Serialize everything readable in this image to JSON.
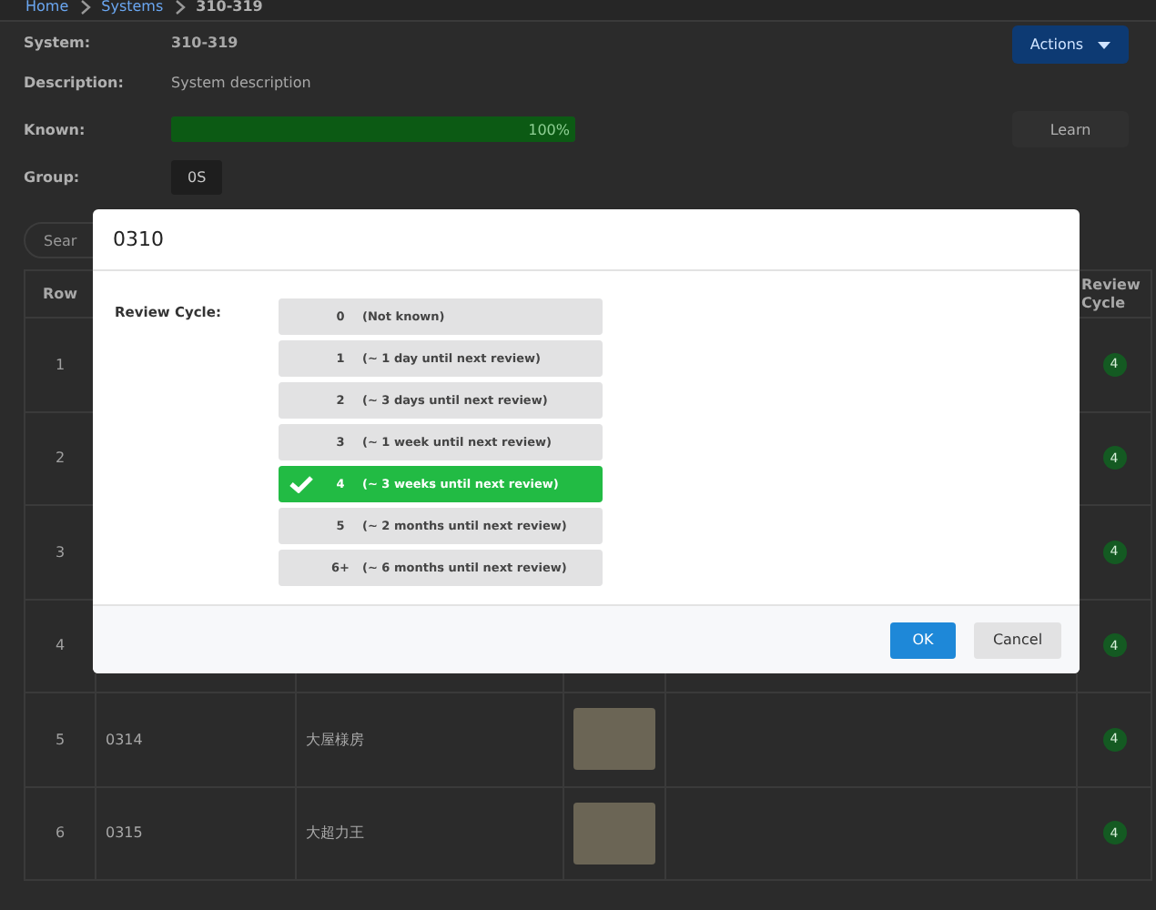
{
  "breadcrumb": [
    "Home",
    "Systems",
    "310-319"
  ],
  "info": {
    "system_label": "System:",
    "system": "310-319",
    "description_label": "Description:",
    "description": "System description",
    "known": {
      "label": "Known:",
      "level": 1.0,
      "reading": "100%"
    },
    "group_label": "Group:",
    "group": "0S"
  },
  "actions_button": "Actions",
  "learn_button": "Learn",
  "search": {
    "placeholder": "Sear"
  },
  "table": {
    "columns": [
      "Row",
      "Review Cycle"
    ],
    "rows": [
      {
        "row": "1",
        "review": "4"
      },
      {
        "row": "2",
        "review": "4"
      },
      {
        "row": "3",
        "review": "4"
      },
      {
        "row": "4",
        "review": "4"
      },
      {
        "row": "5",
        "code": "0314",
        "name": "大屋様房",
        "review": "4",
        "has_photo": true
      },
      {
        "row": "6",
        "code": "0315",
        "name": "大超力王",
        "review": "4",
        "has_photo": true
      }
    ]
  },
  "dialog": {
    "title": "0310",
    "field_label": "Review Cycle:",
    "options": [
      {
        "value": "0",
        "text": "(Not known)",
        "selected": false
      },
      {
        "value": "1",
        "text": "(~ 1 day until next review)",
        "selected": false
      },
      {
        "value": "2",
        "text": "(~ 3 days until next review)",
        "selected": false
      },
      {
        "value": "3",
        "text": "(~ 1 week until next review)",
        "selected": false
      },
      {
        "value": "4",
        "text": "(~ 3 weeks until next review)",
        "selected": true
      },
      {
        "value": "5",
        "text": "(~ 2 months until next review)",
        "selected": false
      },
      {
        "value": "6+",
        "text": "(~ 6 months until next review)",
        "selected": false
      }
    ],
    "buttons": [
      {
        "label": "OK",
        "kind": "primary"
      },
      {
        "label": "Cancel",
        "kind": "secondary"
      }
    ]
  }
}
